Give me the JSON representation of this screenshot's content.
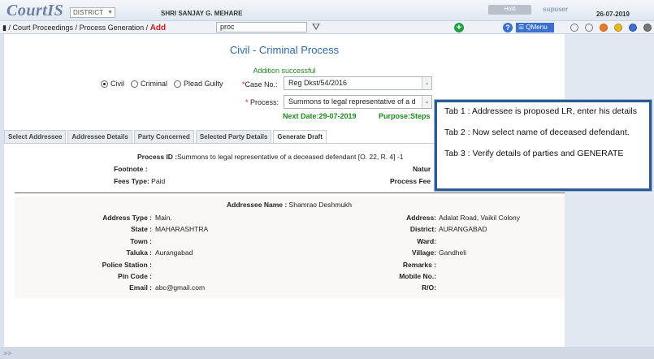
{
  "header": {
    "logo": "CourtIS",
    "district_select": "DISTRICT",
    "user_name": "SHRI SANJAY G. MEHARE",
    "top_button": "Hold",
    "role": "supuser",
    "date": "26-07-2019"
  },
  "nav": {
    "home_sep": "/",
    "crumb1": "Court Proceedings",
    "crumb2": "Process Generation",
    "crumb3": "Add",
    "search_value": "proc",
    "qmenu": "QMenu",
    "dot_colors": [
      "#ffffff",
      "#ffffff",
      "#e87a2a",
      "#e8b82a",
      "#3b6fd1",
      "#777777"
    ]
  },
  "form": {
    "title": "Civil - Criminal Process",
    "success": "Addition successful",
    "radios": [
      {
        "label": "Civil",
        "checked": true
      },
      {
        "label": "Criminal",
        "checked": false
      },
      {
        "label": "Plead Guilty",
        "checked": false
      }
    ],
    "case_no_label": "Case No.:",
    "case_no_value": "Reg Dkst/54/2016",
    "process_label": "Process:",
    "process_value": "Summons to legal representative of a d",
    "next_date": "Next Date:29-07-2019",
    "purpose": "Purpose:Steps"
  },
  "tabs": [
    "Select Addressee",
    "Addressee Details",
    "Party Concerned",
    "Selected Party Details",
    "Generate Draft"
  ],
  "draft": {
    "process_id_label": "Process ID :",
    "process_id_value": "Summons to legal representative of a deceased defendant [O. 22, R. 4] -1",
    "footnote_label": "Footnote :",
    "fees_type_label": "Fees Type:",
    "fees_type_value": "Paid",
    "nature_label": "Natur",
    "process_fee_label": "Process Fee"
  },
  "addressee": {
    "name_label": "Addressee Name :",
    "name_value": "Shamrao Deshmukh",
    "left": [
      {
        "k": "Address Type :",
        "v": "Main."
      },
      {
        "k": "State :",
        "v": "MAHARASHTRA"
      },
      {
        "k": "Town :",
        "v": ""
      },
      {
        "k": "Taluka :",
        "v": "Aurangabad"
      },
      {
        "k": "Police Station :",
        "v": ""
      },
      {
        "k": "Pin Code :",
        "v": ""
      },
      {
        "k": "Email :",
        "v": "abc@gmail.com"
      }
    ],
    "right": [
      {
        "k": "Address:",
        "v": "Adalat Road, Vaikil Colony"
      },
      {
        "k": "District:",
        "v": "AURANGABAD"
      },
      {
        "k": "Ward:",
        "v": ""
      },
      {
        "k": "Village:",
        "v": "Gandheli"
      },
      {
        "k": "Remarks :",
        "v": ""
      },
      {
        "k": "Mobile No.:",
        "v": ""
      },
      {
        "k": "R/O:",
        "v": ""
      }
    ]
  },
  "callout": {
    "tab1": "Tab 1 : Addressee is proposed LR, enter his details",
    "tab2": "Tab 2 : Now select name of deceased defendant.",
    "tab3": "Tab 3 : Verify details of parties and GENERATE"
  },
  "footer": {
    "collapse": ">>"
  }
}
